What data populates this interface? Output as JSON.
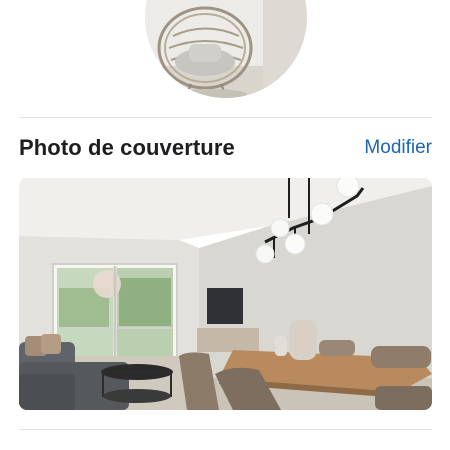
{
  "profile": {
    "photo_icon": "profile-photo"
  },
  "cover_section": {
    "title": "Photo de couverture",
    "edit_label": "Modifier"
  },
  "colors": {
    "link": "#1a66b2",
    "title": "#1c1e21",
    "divider": "#e3e3e3"
  }
}
